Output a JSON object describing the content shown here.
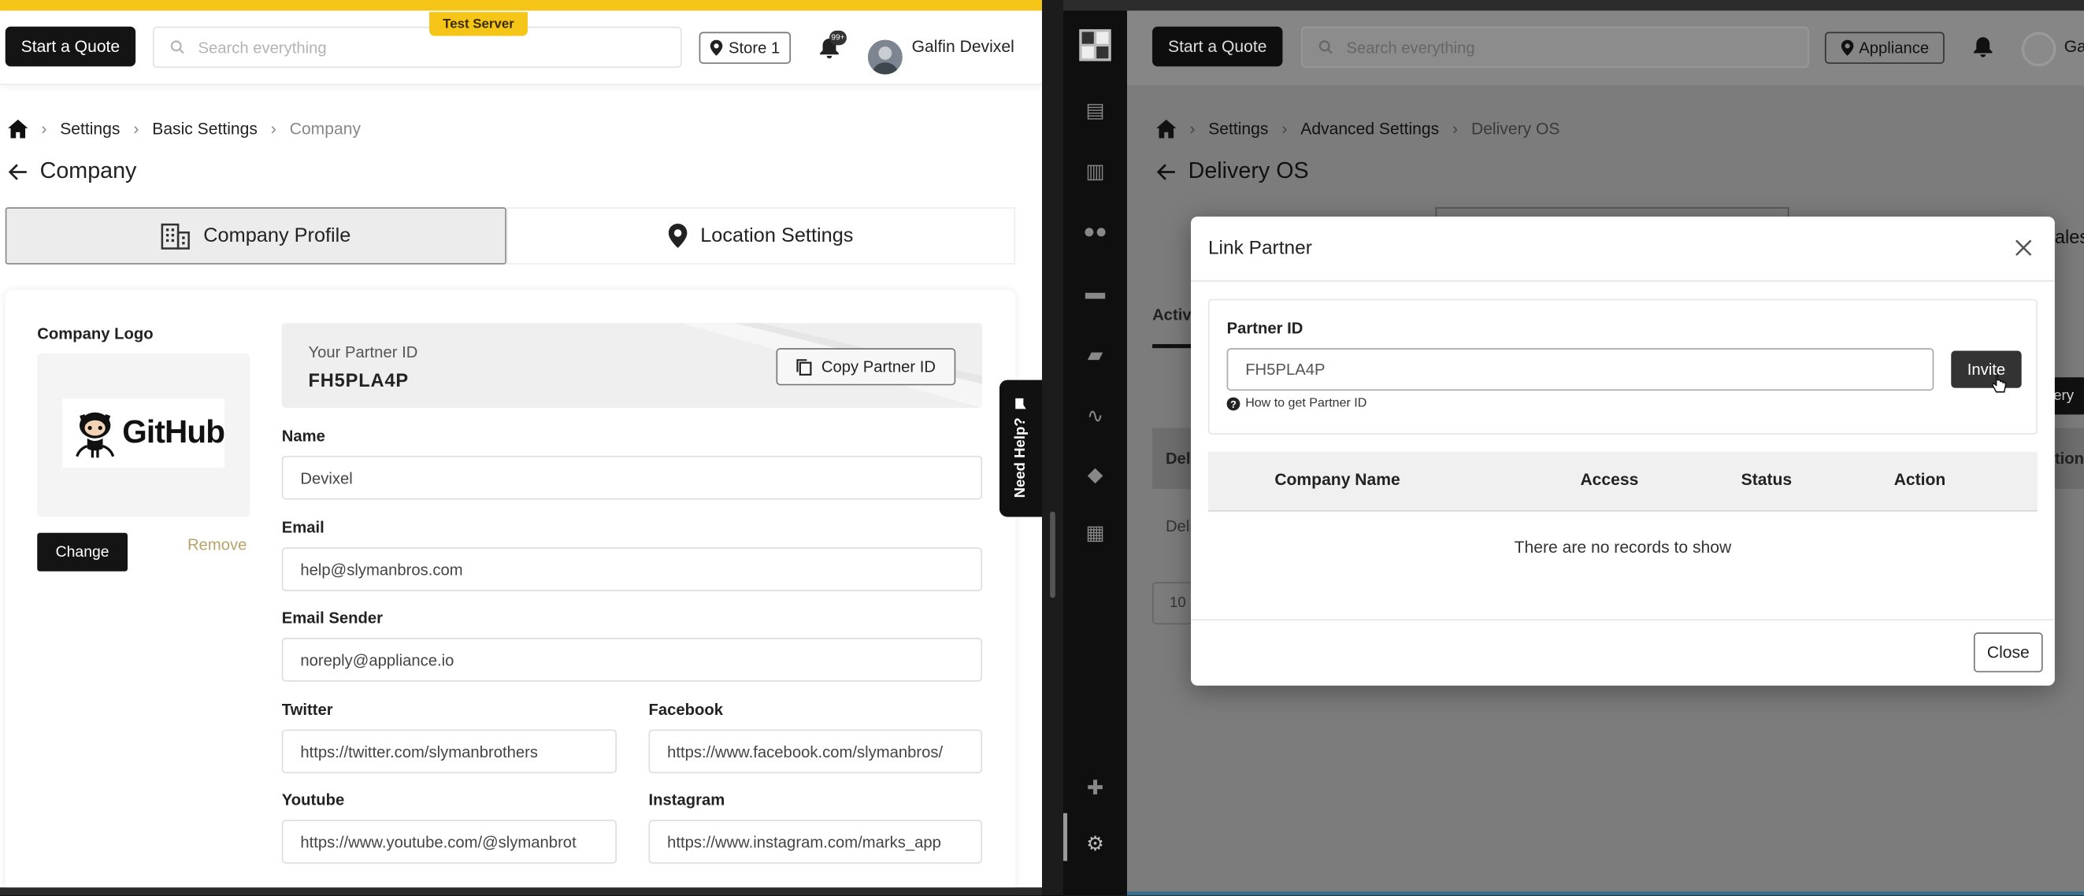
{
  "left": {
    "start_quote": "Start a Quote",
    "search_placeholder": "Search everything",
    "test_badge": "Test Server",
    "store": "Store 1",
    "notif_count": "99+",
    "user_name": "Galfin Devixel",
    "breadcrumb": [
      "Settings",
      "Basic Settings",
      "Company"
    ],
    "page_title": "Company",
    "tabs": [
      "Company Profile",
      "Location Settings"
    ],
    "logo_label": "Company Logo",
    "logo_text": "GitHub",
    "change_btn": "Change",
    "remove_link": "Remove",
    "partner_label": "Your Partner ID",
    "partner_id": "FH5PLA4P",
    "copy_btn": "Copy Partner ID",
    "fields": {
      "name_label": "Name",
      "name_value": "Devixel",
      "email_label": "Email",
      "email_value": "help@slymanbros.com",
      "sender_label": "Email Sender",
      "sender_value": "noreply@appliance.io",
      "twitter_label": "Twitter",
      "twitter_value": "https://twitter.com/slymanbrothers",
      "facebook_label": "Facebook",
      "facebook_value": "https://www.facebook.com/slymanbros/",
      "youtube_label": "Youtube",
      "youtube_value": "https://www.youtube.com/@slymanbrot",
      "instagram_label": "Instagram",
      "instagram_value": "https://www.instagram.com/marks_app"
    },
    "need_help": "Need Help?"
  },
  "right": {
    "start_quote": "Start a Quote",
    "search_placeholder": "Search everything",
    "store": "Appliance",
    "user_initials": "Ga",
    "breadcrumb": [
      "Settings",
      "Advanced Settings",
      "Delivery OS"
    ],
    "page_title": "Delivery OS",
    "bg_tab_fragment": "Activ",
    "bg_side_fragment": "ales",
    "bg_btn_fragment": "ery",
    "bg_col_fragment": "Del",
    "bg_col_fragment2": "tion",
    "bg_row_fragment": "Deli",
    "bg_page_size": "10",
    "modal": {
      "title": "Link Partner",
      "partner_label": "Partner ID",
      "partner_value": "FH5PLA4P",
      "invite": "Invite",
      "help": "How to get Partner ID",
      "columns": [
        "Company Name",
        "Access",
        "Status",
        "Action"
      ],
      "empty": "There are no records to show",
      "close": "Close"
    }
  },
  "colors": {
    "accent": "#f5c518",
    "dark": "#141414",
    "remove": "#b8a36a"
  }
}
